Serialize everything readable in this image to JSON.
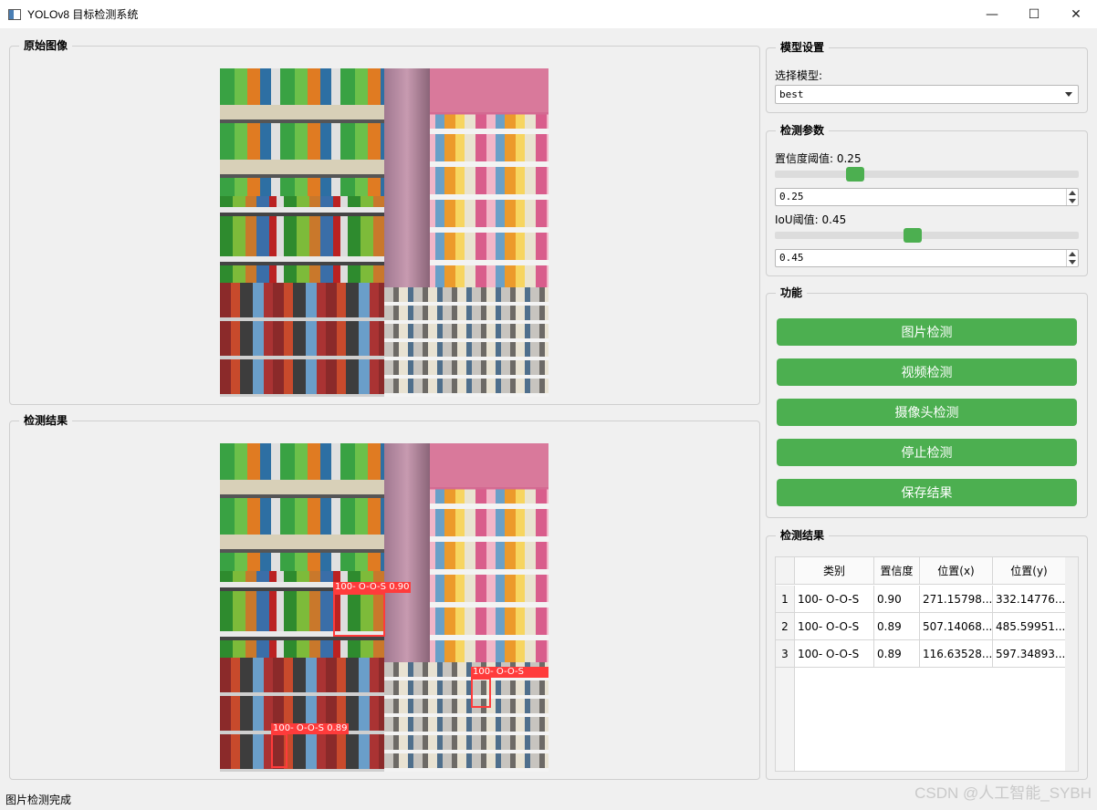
{
  "window": {
    "title": "YOLOv8 目标检测系统",
    "minimize": "—",
    "maximize": "☐",
    "close": "✕"
  },
  "original_panel": {
    "title": "原始图像"
  },
  "result_panel": {
    "title": "检测结果",
    "detections": [
      {
        "label": "100- O-O-S 0.90"
      },
      {
        "label": "100- O-O-S"
      },
      {
        "label": "100- O-O-S 0.89"
      }
    ]
  },
  "model_settings": {
    "title": "模型设置",
    "select_label": "选择模型:",
    "selected_model": "best"
  },
  "detect_params": {
    "title": "检测参数",
    "conf_label": "置信度阈值: 0.25",
    "conf_value": "0.25",
    "conf_level": 0.25,
    "iou_label": "IoU阈值: 0.45",
    "iou_value": "0.45",
    "iou_level": 0.45
  },
  "functions": {
    "title": "功能",
    "buttons": [
      "图片检测",
      "视频检测",
      "摄像头检测",
      "停止检测",
      "保存结果"
    ],
    "button_color": "#4caf50"
  },
  "results_table": {
    "title": "检测结果",
    "headers": [
      "类别",
      "置信度",
      "位置(x)",
      "位置(y)"
    ],
    "rows": [
      {
        "index": "1",
        "cls": "100- O-O-S",
        "conf": "0.90",
        "x": "271.15798...",
        "y": "332.14776..."
      },
      {
        "index": "2",
        "cls": "100- O-O-S",
        "conf": "0.89",
        "x": "507.14068...",
        "y": "485.59951..."
      },
      {
        "index": "3",
        "cls": "100- O-O-S",
        "conf": "0.89",
        "x": "116.63528...",
        "y": "597.34893..."
      }
    ]
  },
  "status": {
    "text": "图片检测完成"
  },
  "watermark": "CSDN @人工智能_SYBH",
  "accent_color": "#4caf50",
  "detection_color": "#ff3b3b"
}
